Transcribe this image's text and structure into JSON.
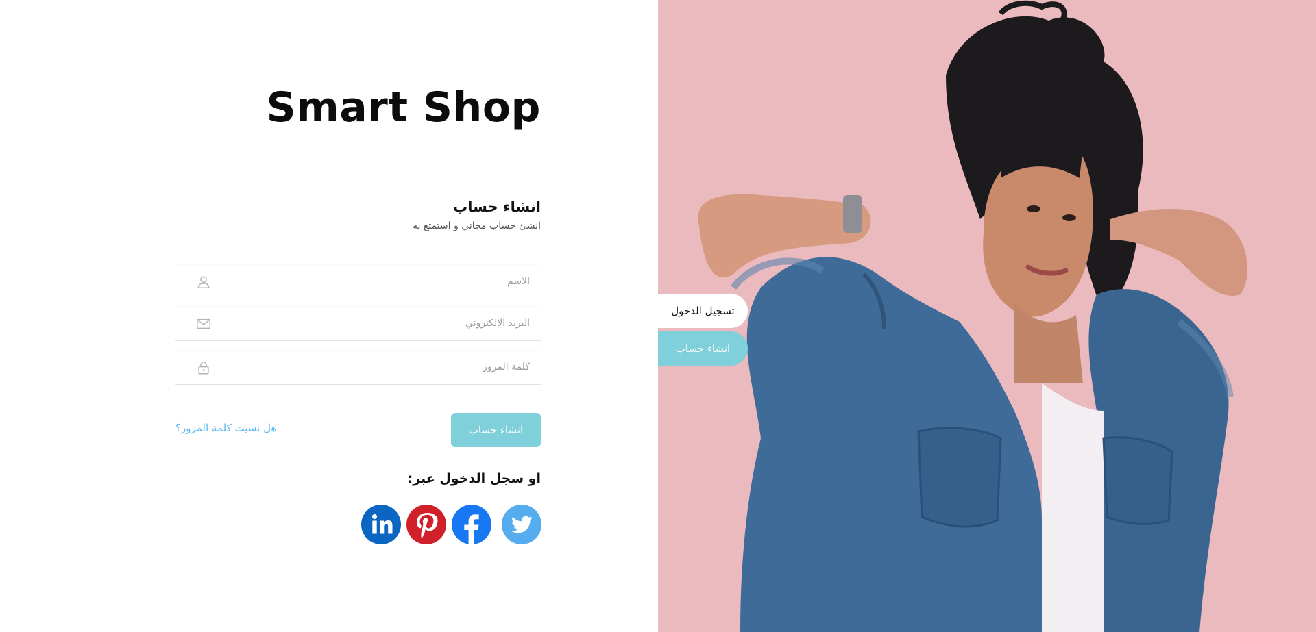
{
  "brand": {
    "title": "Smart Shop"
  },
  "form": {
    "heading": "انشاء حساب",
    "subtitle": "انشئ حساب مجاني و استمتع به",
    "fields": [
      {
        "placeholder": "الاسم",
        "icon": "user-icon"
      },
      {
        "placeholder": "البريد الالكتروني",
        "icon": "mail-icon"
      },
      {
        "placeholder": "كلمة المرور",
        "icon": "lock-icon"
      }
    ],
    "submit_label": "انشاء حساب",
    "forgot_label": "هل نسيت كلمة المرور؟"
  },
  "social": {
    "heading": "او سجل الدخول عبر:",
    "networks": [
      {
        "name": "linkedin-icon",
        "color": "#0a66c2"
      },
      {
        "name": "pinterest-icon",
        "color": "#d0212b"
      },
      {
        "name": "facebook-icon",
        "color": "#1877f2"
      },
      {
        "name": "twitter-icon",
        "color": "#55acee"
      }
    ]
  },
  "tabs": {
    "login_label": "تسجيل الدخول",
    "signup_label": "انشاء حساب"
  },
  "colors": {
    "accent": "#7fd0db",
    "link": "#5bb8f0",
    "photo_bg": "#e7b4b8",
    "denim": "#3d6a96"
  }
}
